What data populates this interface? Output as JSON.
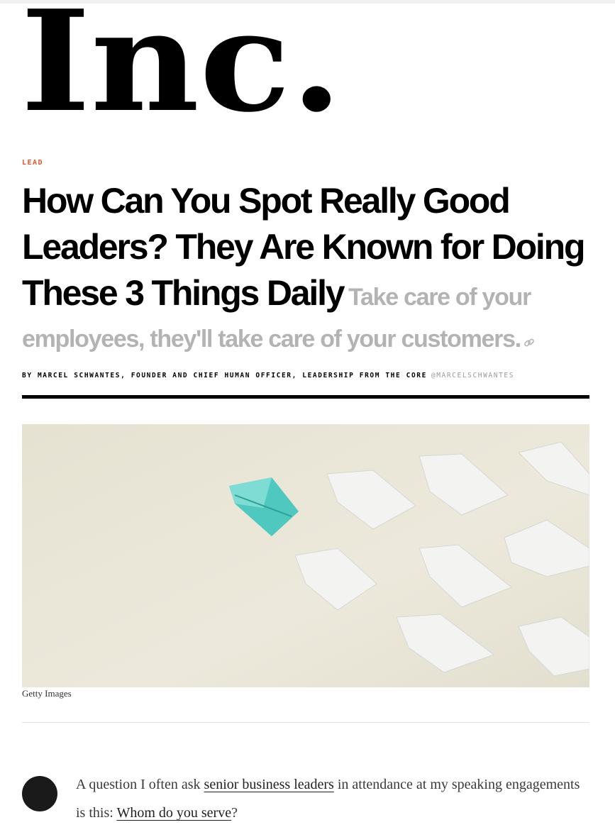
{
  "brand": {
    "logo_text": "Inc."
  },
  "article": {
    "category": "LEAD",
    "title": "How Can You Spot Really Good Leaders? They Are Known for Doing These 3 Things Daily",
    "dek": "Take care of your employees, they'll take care of your customers.",
    "byline": "BY MARCEL SCHWANTES, FOUNDER AND CHIEF HUMAN OFFICER, LEADERSHIP FROM THE CORE",
    "author_handle": "@MARCELSCHWANTES",
    "image_credit": "Getty Images",
    "body": {
      "p1_before": "A question I often ask ",
      "p1_link1": "senior business leaders",
      "p1_middle": " in attendance at my speaking engagements is this: ",
      "p1_link2": "Whom do you serve",
      "p1_after": "?"
    }
  },
  "icons": {
    "share_link": "link-icon",
    "avatar": "author-avatar"
  },
  "colors": {
    "accent": "#e8522a",
    "dek": "#b3b3b3",
    "handle": "#9a9a9a",
    "boat_leader": "#4fc8c0",
    "boat_follower": "#f2f2f2",
    "image_background": "#ebe7d9"
  }
}
